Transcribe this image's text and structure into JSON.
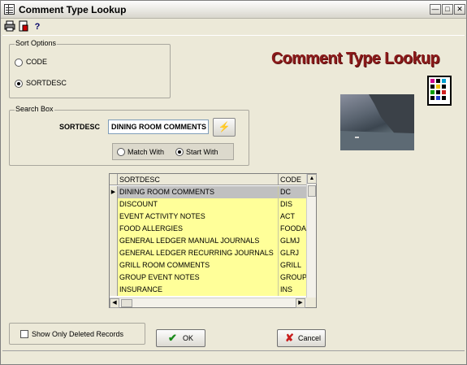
{
  "window": {
    "title": "Comment Type Lookup",
    "controls": [
      "minimize",
      "maximize",
      "close"
    ]
  },
  "toolbar": {
    "icons": [
      "printer-icon",
      "report-icon",
      "help-icon"
    ],
    "help_label": "?"
  },
  "sort_options": {
    "legend": "Sort Options",
    "options": [
      {
        "label": "CODE",
        "selected": false
      },
      {
        "label": "SORTDESC",
        "selected": true
      }
    ]
  },
  "banner": {
    "title": "Comment Type Lookup"
  },
  "search_box": {
    "legend": "Search Box",
    "field_label": "SORTDESC",
    "value": "DINING ROOM COMMENTS",
    "match_options": [
      {
        "label": "Match With",
        "selected": false
      },
      {
        "label": "Start With",
        "selected": true
      }
    ]
  },
  "grid": {
    "columns": [
      "SORTDESC",
      "CODE"
    ],
    "rows": [
      {
        "desc": "DINING ROOM COMMENTS",
        "code": "DC",
        "current": true
      },
      {
        "desc": "DISCOUNT",
        "code": "DIS",
        "current": false
      },
      {
        "desc": "EVENT ACTIVITY NOTES",
        "code": "ACT",
        "current": false
      },
      {
        "desc": "FOOD ALLERGIES",
        "code": "FOODA",
        "current": false
      },
      {
        "desc": "GENERAL LEDGER MANUAL JOURNALS",
        "code": "GLMJ",
        "current": false
      },
      {
        "desc": "GENERAL LEDGER RECURRING JOURNALS",
        "code": "GLRJ",
        "current": false
      },
      {
        "desc": "GRILL ROOM COMMENTS",
        "code": "GRILL",
        "current": false
      },
      {
        "desc": "GROUP EVENT NOTES",
        "code": "GROUP",
        "current": false
      },
      {
        "desc": "INSURANCE",
        "code": "INS",
        "current": false
      }
    ]
  },
  "footer": {
    "show_deleted_label": "Show Only Deleted Records",
    "show_deleted_checked": false,
    "ok_label": "OK",
    "cancel_label": "Cancel"
  },
  "colors": {
    "banner": "#8b1a1a",
    "grid_row": "#ffff99",
    "grid_selected": "#c0c0c0"
  }
}
